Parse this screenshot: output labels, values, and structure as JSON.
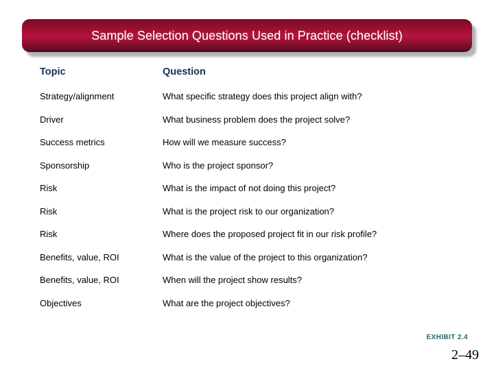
{
  "slide": {
    "title": "Sample Selection Questions Used in Practice (checklist)",
    "banner_color": "#a40f34",
    "title_text_color": "#ffffff"
  },
  "table": {
    "headers": {
      "topic": "Topic",
      "question": "Question"
    },
    "header_color": "#143255",
    "rows": [
      {
        "topic": "Strategy/alignment",
        "question": "What specific strategy does this project align with?"
      },
      {
        "topic": "Driver",
        "question": "What business problem does the project solve?"
      },
      {
        "topic": "Success metrics",
        "question": "How will we measure success?"
      },
      {
        "topic": "Sponsorship",
        "question": "Who is the project sponsor?"
      },
      {
        "topic": "Risk",
        "question": "What is the impact of not doing this project?"
      },
      {
        "topic": "Risk",
        "question": "What is the project risk to our organization?"
      },
      {
        "topic": "Risk",
        "question": "Where does the proposed project fit in our risk profile?"
      },
      {
        "topic": "Benefits, value, ROI",
        "question": "What is the value of the project to this organization?"
      },
      {
        "topic": "Benefits, value, ROI",
        "question": "When will the project show results?"
      },
      {
        "topic": "Objectives",
        "question": "What are the project objectives?"
      }
    ]
  },
  "footer": {
    "exhibit_label": "EXHIBIT 2.4",
    "exhibit_color": "#1d6b6b",
    "page_number": "2–49"
  }
}
